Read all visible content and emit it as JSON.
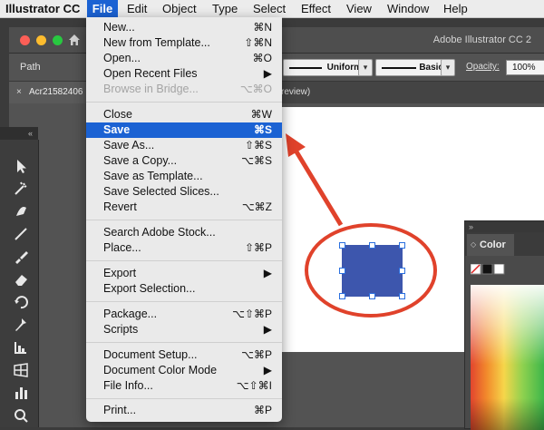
{
  "menubar": {
    "app": "Illustrator CC",
    "items": [
      "File",
      "Edit",
      "Object",
      "Type",
      "Select",
      "Effect",
      "View",
      "Window",
      "Help"
    ]
  },
  "window": {
    "title": "Adobe Illustrator CC 2"
  },
  "control_bar": {
    "selection_label": "Path",
    "stroke_profile": "Uniform",
    "brush": "Basic",
    "opacity_label": "Opacity:",
    "opacity_value": "100%"
  },
  "tabs": {
    "doc_name": "Acr21582406",
    "close": "×",
    "suffix": "review)"
  },
  "color_panel": {
    "tab": "Color"
  },
  "file_menu": {
    "items": [
      {
        "label": "New...",
        "shortcut": "⌘N"
      },
      {
        "label": "New from Template...",
        "shortcut": "⇧⌘N"
      },
      {
        "label": "Open...",
        "shortcut": "⌘O"
      },
      {
        "label": "Open Recent Files",
        "shortcut": "▶"
      },
      {
        "label": "Browse in Bridge...",
        "shortcut": "⌥⌘O",
        "disabled": true
      },
      {
        "label": "Close",
        "shortcut": "⌘W"
      },
      {
        "label": "Save",
        "shortcut": "⌘S",
        "highlighted": true
      },
      {
        "label": "Save As...",
        "shortcut": "⇧⌘S"
      },
      {
        "label": "Save a Copy...",
        "shortcut": "⌥⌘S"
      },
      {
        "label": "Save as Template..."
      },
      {
        "label": "Save Selected Slices..."
      },
      {
        "label": "Revert",
        "shortcut": "⌥⌘Z"
      },
      {
        "label": "Search Adobe Stock..."
      },
      {
        "label": "Place...",
        "shortcut": "⇧⌘P"
      },
      {
        "label": "Export",
        "shortcut": "▶"
      },
      {
        "label": "Export Selection..."
      },
      {
        "label": "Package...",
        "shortcut": "⌥⇧⌘P"
      },
      {
        "label": "Scripts",
        "shortcut": "▶"
      },
      {
        "label": "Document Setup...",
        "shortcut": "⌥⌘P"
      },
      {
        "label": "Document Color Mode",
        "shortcut": "▶"
      },
      {
        "label": "File Info...",
        "shortcut": "⌥⇧⌘I"
      },
      {
        "label": "Print...",
        "shortcut": "⌘P"
      }
    ]
  },
  "colors": {
    "accent": "#1b62d3",
    "annotation": "#e0422b",
    "shape_fill": "#3d56ad"
  }
}
